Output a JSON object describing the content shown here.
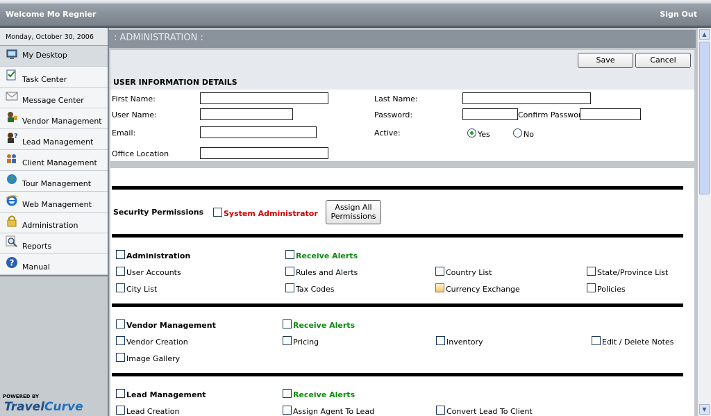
{
  "header": {
    "welcome": "Welcome Mo Regnier",
    "sign_out": "Sign Out"
  },
  "sidebar": {
    "date": "Monday, October 30, 2006",
    "items": [
      {
        "label": "My Desktop",
        "icon": "desktop-icon"
      },
      {
        "label": "Task Center",
        "icon": "task-icon"
      },
      {
        "label": "Message Center",
        "icon": "envelope-icon"
      },
      {
        "label": "Vendor Management",
        "icon": "vendor-icon"
      },
      {
        "label": "Lead Management",
        "icon": "lead-icon"
      },
      {
        "label": "Client Management",
        "icon": "clients-icon"
      },
      {
        "label": "Tour Management",
        "icon": "globe-icon"
      },
      {
        "label": "Web Management",
        "icon": "ie-icon"
      },
      {
        "label": "Administration",
        "icon": "lock-icon"
      },
      {
        "label": "Reports",
        "icon": "magnifier-icon"
      },
      {
        "label": "Manual",
        "icon": "help-icon"
      }
    ],
    "powered_by": "POWERED BY",
    "logo_part1": "Travel",
    "logo_part2": "Curve"
  },
  "main": {
    "title": ": ADMINISTRATION :",
    "save": "Save",
    "cancel": "Cancel",
    "section_title": "USER INFORMATION DETAILS",
    "labels": {
      "first_name": "First Name:",
      "last_name": "Last Name:",
      "user_name": "User Name:",
      "password": "Password:",
      "confirm_password": "Confirm Password",
      "email": "Email:",
      "active": "Active:",
      "yes": "Yes",
      "no": "No",
      "office_location": "Office Location"
    },
    "values": {
      "first_name": "",
      "last_name": "",
      "user_name": "",
      "password": "",
      "confirm_password": "",
      "email": "",
      "office_location": ""
    },
    "active_selected": "Yes"
  },
  "permissions": {
    "title": "Security Permissions",
    "system_admin": "System Administrator",
    "assign_line1": "Assign All",
    "assign_line2": "Permissions",
    "groups": [
      {
        "name": "Administration",
        "alerts": "Receive Alerts",
        "items": [
          "User Accounts",
          "Rules and Alerts",
          "Country List",
          "State/Province List",
          "City List",
          "Tax Codes",
          "Currency Exchange",
          "Policies"
        ]
      },
      {
        "name": "Vendor Management",
        "alerts": "Receive Alerts",
        "items": [
          "Vendor Creation",
          "Pricing",
          "Inventory",
          "Edit / Delete Notes",
          "Image Gallery"
        ]
      },
      {
        "name": "Lead Management",
        "alerts": "Receive Alerts",
        "items": [
          "Lead Creation",
          "Assign Agent To Lead",
          "Convert Lead To Client"
        ]
      }
    ]
  },
  "colors": {
    "header_gray": "#868f97",
    "admin_header": "#8a939b",
    "red_label": "#d10000",
    "green_label": "#0f8a0f",
    "logo_blue": "#1f4f86"
  }
}
